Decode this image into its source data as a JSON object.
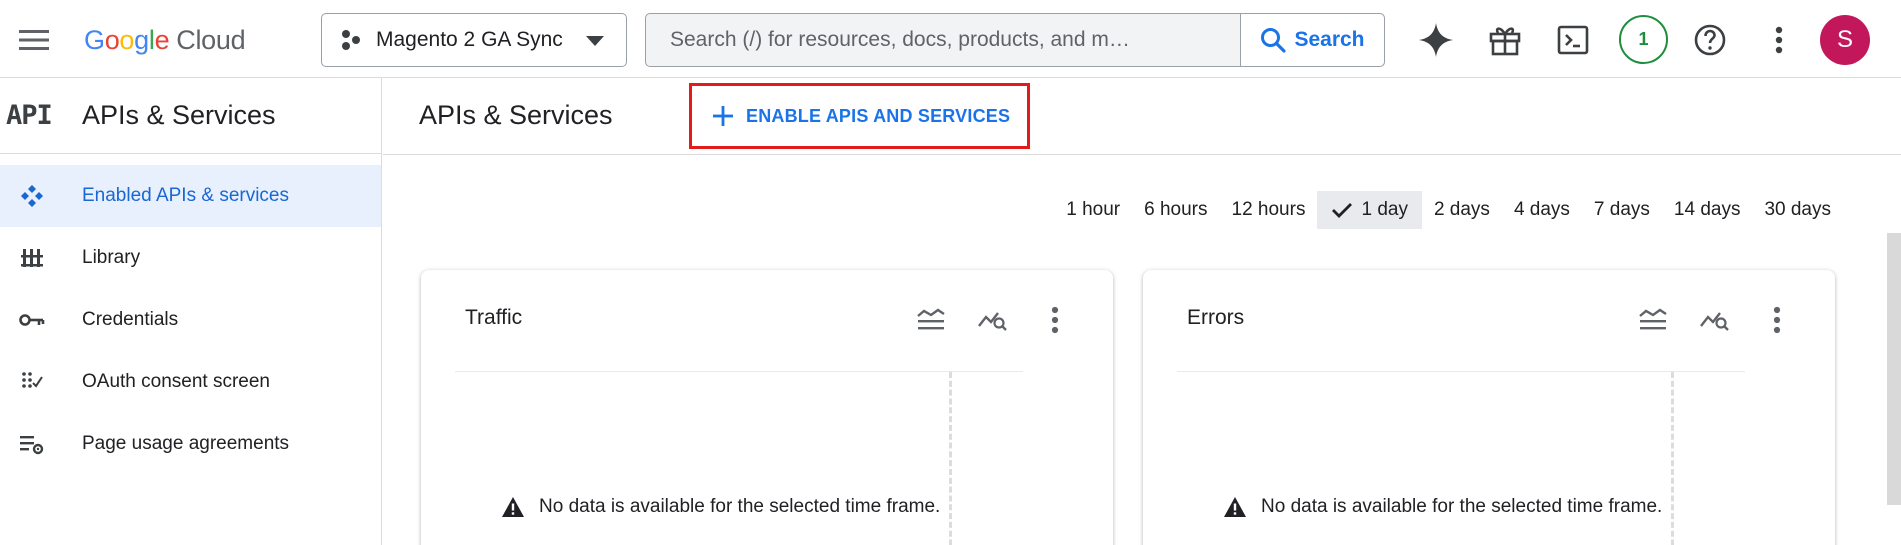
{
  "topbar": {
    "brand": {
      "letters": [
        "G",
        "o",
        "o",
        "g",
        "l",
        "e"
      ],
      "product": "Cloud"
    },
    "project": {
      "name": "Magento 2 GA Sync"
    },
    "search": {
      "placeholder": "Search (/) for resources, docs, products, and m…",
      "button_label": "Search"
    },
    "notifications_count": "1",
    "avatar_initial": "S"
  },
  "sidebar": {
    "logo": "API",
    "title": "APIs & Services",
    "items": [
      {
        "label": "Enabled APIs & services",
        "icon": "enabled-apis-icon",
        "active": true
      },
      {
        "label": "Library",
        "icon": "library-icon",
        "active": false
      },
      {
        "label": "Credentials",
        "icon": "key-icon",
        "active": false
      },
      {
        "label": "OAuth consent screen",
        "icon": "oauth-consent-icon",
        "active": false
      },
      {
        "label": "Page usage agreements",
        "icon": "page-usage-settings-icon",
        "active": false
      }
    ]
  },
  "main": {
    "title": "APIs & Services",
    "enable_button": "ENABLE APIS AND SERVICES",
    "time_range": {
      "options": [
        "1 hour",
        "6 hours",
        "12 hours",
        "1 day",
        "2 days",
        "4 days",
        "7 days",
        "14 days",
        "30 days"
      ],
      "selected": "1 day"
    },
    "cards": [
      {
        "title": "Traffic",
        "empty_message": "No data is available for the selected time frame."
      },
      {
        "title": "Errors",
        "empty_message": "No data is available for the selected time frame."
      }
    ]
  },
  "colors": {
    "accent_blue": "#1a73e8",
    "highlight_red": "#e21b1b",
    "notification_green": "#1e8e3e",
    "avatar_bg": "#c2185b"
  }
}
